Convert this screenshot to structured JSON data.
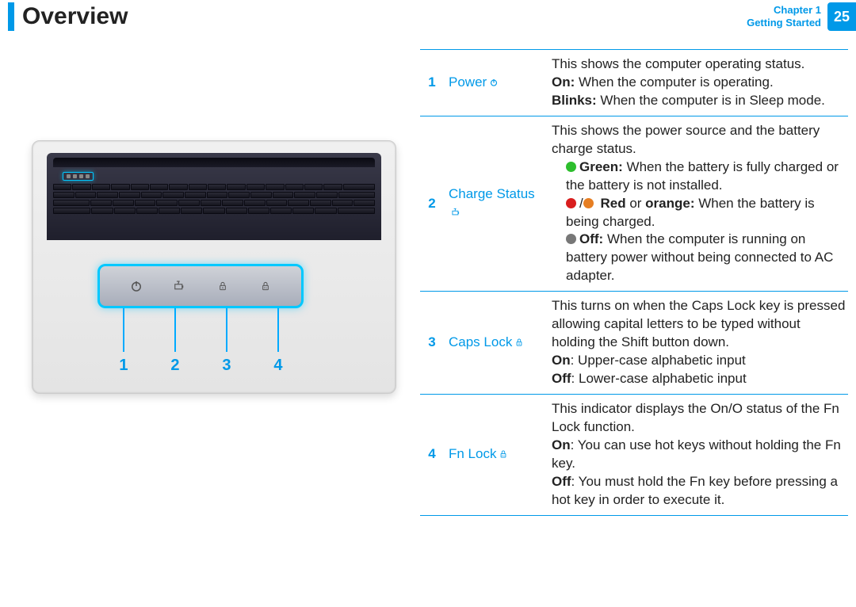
{
  "header": {
    "title": "Overview",
    "chapter_label": "Chapter 1",
    "section_label": "Getting Started",
    "page_number": "25"
  },
  "callouts": [
    "1",
    "2",
    "3",
    "4"
  ],
  "rows": [
    {
      "num": "1",
      "name": "Power",
      "desc_intro": "This shows the computer operating status.",
      "on_label": "On:",
      "on_text": " When the computer is operating.",
      "blinks_label": "Blinks:",
      "blinks_text": " When the computer is in Sleep mode."
    },
    {
      "num": "2",
      "name": "Charge Status",
      "desc_intro": "This shows the power source and the battery charge status.",
      "green_label": "Green:",
      "green_text": " When the battery is fully charged or the battery is not installed.",
      "red_label_1": "Red",
      "red_or": " or ",
      "red_label_2": "orange:",
      "red_text": " When the battery is being charged.",
      "off_label": "Off:",
      "off_text": " When the computer is running on battery power without being connected to AC adapter."
    },
    {
      "num": "3",
      "name": "Caps Lock",
      "desc_intro": "This turns on when the Caps Lock key is pressed allowing capital letters to be typed without holding the Shift button down.",
      "on_label": "On",
      "on_text": ": Upper-case alphabetic input",
      "off_label": "Off",
      "off_text": ": Lower-case alphabetic input"
    },
    {
      "num": "4",
      "name": "Fn Lock",
      "desc_intro": "This indicator displays the On/O  status of the Fn Lock function.",
      "on_label": "On",
      "on_text": ": You can use hot keys without holding the Fn key.",
      "off_label": "Off",
      "off_text": ": You must hold the Fn key before pressing a hot key in order to execute it."
    }
  ]
}
